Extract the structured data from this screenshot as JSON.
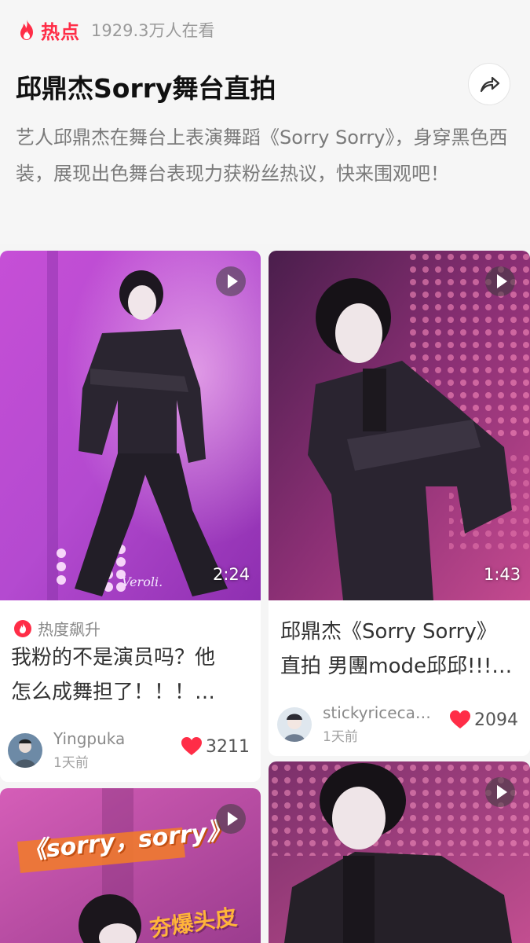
{
  "header": {
    "hot_label": "热点",
    "viewers": "1929.3万人在看",
    "title": "邱鼎杰Sorry舞台直拍",
    "description": "艺人邱鼎杰在舞台上表演舞蹈《Sorry Sorry》，身穿黑色西装，展现出色舞台表现力获粉丝热议，快来围观吧！",
    "accent_color": "#ff2d47"
  },
  "cards": [
    {
      "duration": "2:24",
      "watermark": "Veroli.",
      "badge": "热度飙升",
      "title_line1": "我粉的不是演员吗？他",
      "title_line2": "怎么成舞担了！！！…",
      "author": "Yingpuka",
      "time": "1天前",
      "likes": "3211"
    },
    {
      "duration": "1:43",
      "title_line1": "邱鼎杰《Sorry Sorry》",
      "title_line2": "直拍 男團mode邱邱!!!…",
      "author": "stickyriceca…",
      "time": "1天前",
      "likes": "2094"
    },
    {
      "overlay_text1": "《sorry，sorry》",
      "overlay_text2": "夯爆头皮"
    },
    {}
  ],
  "icons": {
    "hot": "flame-icon",
    "share": "share-arrow-icon",
    "play": "play-icon",
    "like": "heart-icon",
    "trend": "flame-badge-icon"
  }
}
